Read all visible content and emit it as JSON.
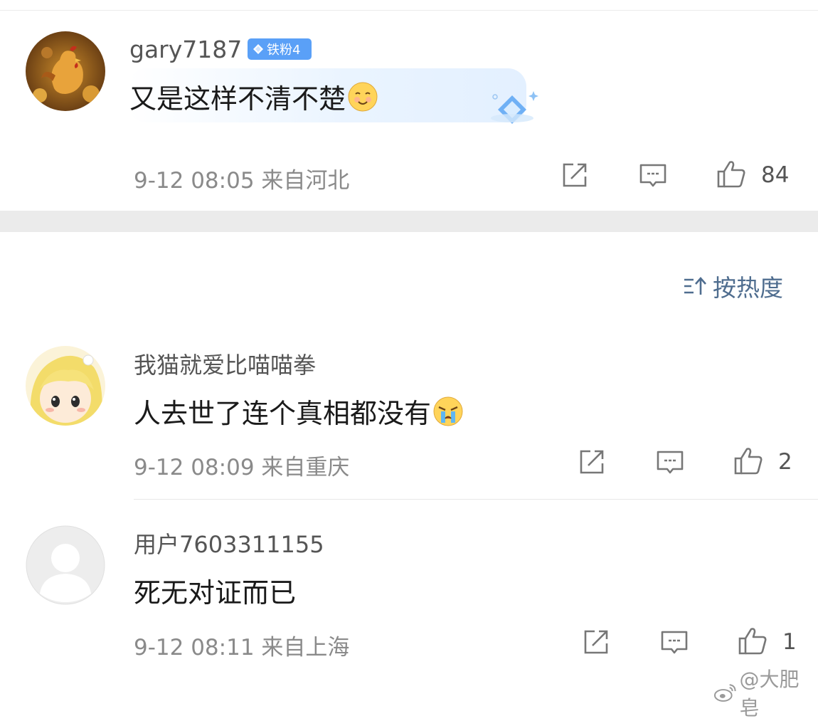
{
  "comments": [
    {
      "username": "gary7187",
      "badge": "铁粉4",
      "text": "又是这样不清不楚",
      "emoji": "smiling-face-emoji",
      "time": "9-12 08:05",
      "location": "来自河北",
      "likes": "84"
    },
    {
      "username": "我猫就爱比喵喵拳",
      "text": "人去世了连个真相都没有",
      "emoji": "crying-face-emoji",
      "time": "9-12 08:09",
      "location": "来自重庆",
      "likes": "2"
    },
    {
      "username": "用户7603311155",
      "text": "死无对证而已",
      "time": "9-12 08:11",
      "location": "来自上海",
      "likes": "1"
    }
  ],
  "sort": {
    "label": "按热度",
    "icon": "sort-icon"
  },
  "watermark": {
    "text": "@大肥皂",
    "icon": "weibo-logo-icon"
  },
  "colors": {
    "badge": "#5aa0f7",
    "sort": "#4f6d8f",
    "meta": "#8a8a8a",
    "separator": "#ebebeb"
  }
}
